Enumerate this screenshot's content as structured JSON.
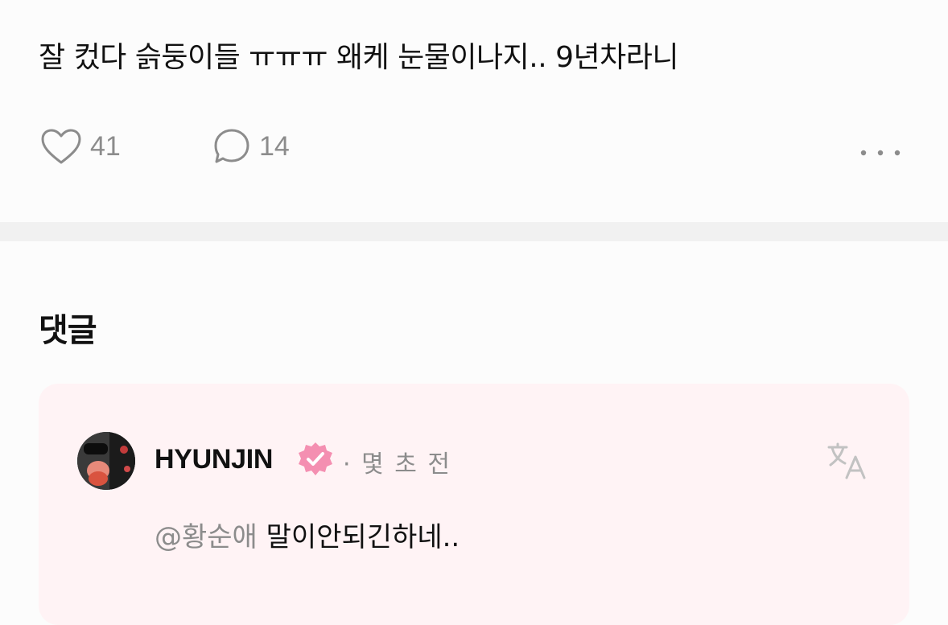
{
  "post": {
    "body": "잘 컸다 슭둥이들 ㅠㅠㅠ 왜케 눈물이나지.. 9년차라니",
    "likes": "41",
    "comments": "14"
  },
  "comments_section": {
    "title": "댓글"
  },
  "comment": {
    "username": "HYUNJIN",
    "separator": "·",
    "time": "몇 초 전",
    "mention": "@황순애",
    "text": "말이안되긴하네.."
  },
  "colors": {
    "accent_pink": "#f48fb1",
    "card_bg": "#fff3f5",
    "muted": "#8c8c8c"
  },
  "icons": [
    "heart-icon",
    "comment-bubble-icon",
    "more-options-icon",
    "verified-badge-icon",
    "translate-icon"
  ]
}
